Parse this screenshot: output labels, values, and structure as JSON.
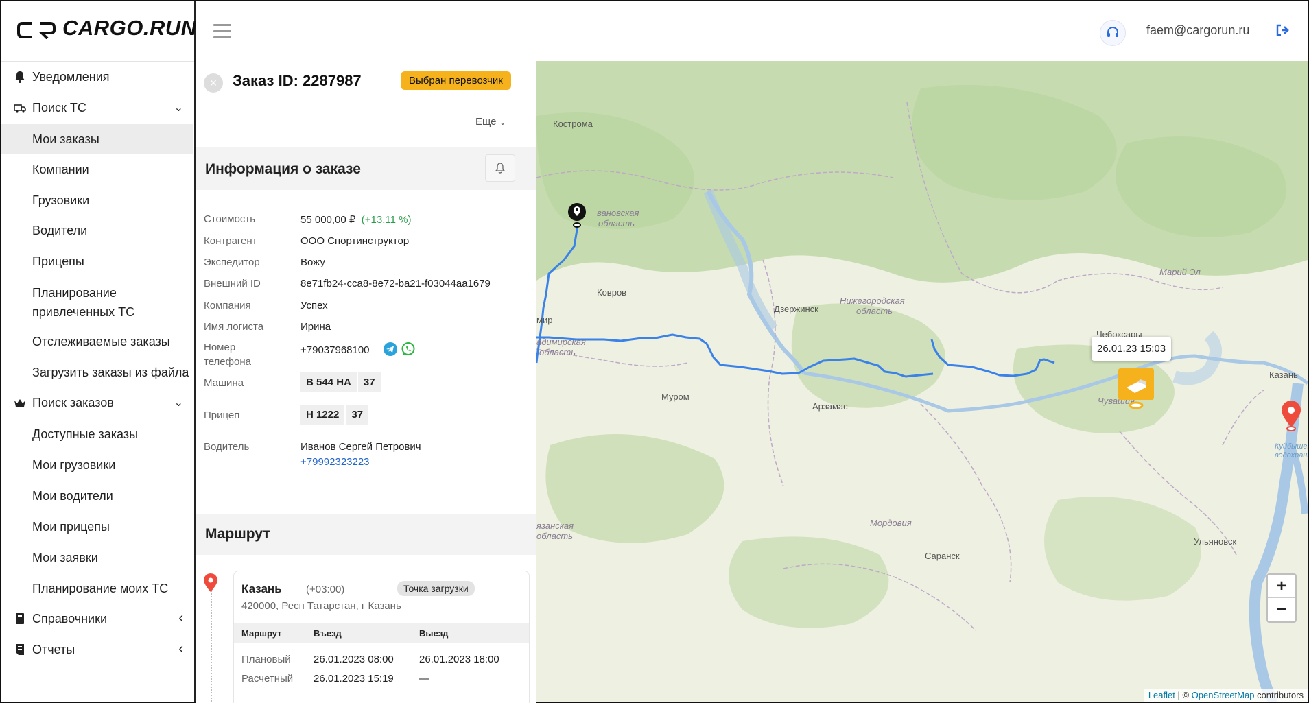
{
  "app": {
    "logo_text": "CARGO.RUN"
  },
  "sidebar": {
    "items": [
      {
        "label": "Уведомления",
        "icon": "bell-icon"
      },
      {
        "label": "Поиск ТС",
        "icon": "truck-icon"
      },
      {
        "label": "Мои заказы"
      },
      {
        "label": "Компании"
      },
      {
        "label": "Грузовики"
      },
      {
        "label": "Водители"
      },
      {
        "label": "Прицепы"
      },
      {
        "label": "Планирование привлеченных ТС"
      },
      {
        "label": "Отслеживаемые заказы"
      },
      {
        "label": "Загрузить заказы из файла"
      },
      {
        "label": "Поиск заказов",
        "icon": "crown-icon"
      },
      {
        "label": "Доступные заказы"
      },
      {
        "label": "Мои грузовики"
      },
      {
        "label": "Мои водители"
      },
      {
        "label": "Мои прицепы"
      },
      {
        "label": "Мои заявки"
      },
      {
        "label": "Планирование моих ТС"
      },
      {
        "label": "Справочники",
        "icon": "book-icon"
      },
      {
        "label": "Отчеты",
        "icon": "report-icon"
      }
    ]
  },
  "header": {
    "user_email": "faem@cargorun.ru"
  },
  "order": {
    "title": "Заказ ID: 2287987",
    "status": "Выбран перевозчик",
    "more_label": "Еще",
    "info_title": "Информация о заказе",
    "fields": {
      "cost_label": "Стоимость",
      "cost_value": "55 000,00 ₽",
      "cost_change": "(+13,11 %)",
      "counterparty_label": "Контрагент",
      "counterparty_value": "ООО Спортинструктор",
      "forwarder_label": "Экспедитор",
      "forwarder_value": "Вожу",
      "external_id_label": "Внешний ID",
      "external_id_value": "8e71fb24-cca8-8e72-ba21-f03044aa1679",
      "company_label": "Компания",
      "company_value": "Успех",
      "logist_label": "Имя логиста",
      "logist_value": "Ирина",
      "phone_label_1": "Номер",
      "phone_label_2": "телефона",
      "phone_value": "+79037968100",
      "vehicle_label": "Машина",
      "vehicle_plate": "В 544 НА",
      "vehicle_region": "37",
      "trailer_label": "Прицеп",
      "trailer_plate": "Н 1222",
      "trailer_region": "37",
      "driver_label": "Водитель",
      "driver_name": "Иванов Сергей Петрович",
      "driver_phone": "+79992323223"
    },
    "route_title": "Маршрут",
    "stop": {
      "city": "Казань",
      "tz": "(+03:00)",
      "badge": "Точка загрузки",
      "address": "420000, Респ Татарстан, г Казань",
      "col_route": "Маршрут",
      "col_in": "Въезд",
      "col_out": "Выезд",
      "row1_label": "Плановый",
      "row1_in": "26.01.2023 08:00",
      "row1_out": "26.01.2023 18:00",
      "row2_label": "Расчетный",
      "row2_in": "26.01.2023 15:19",
      "row2_out": "—"
    }
  },
  "map": {
    "tooltip": "26.01.23 15:03",
    "labels": {
      "kostroma": "Кострома",
      "ivanovo_1": "вановская",
      "ivanovo_2": "область",
      "kovrov": "Ковров",
      "dzerzhinsk": "Дзержинск",
      "nizh_1": "Нижегородская",
      "nizh_2": "область",
      "vlad_city": "мир",
      "vlad_1": "адимирская",
      "vlad_2": "область",
      "murom": "Муром",
      "arzamas": "Арзамас",
      "cheboksary": "Чебоксары",
      "mariel": "Марий Эл",
      "chuvash": "Чувашия",
      "kazan": "Казань",
      "mordovia": "Мордовия",
      "saransk": "Саранск",
      "ulyanovsk": "Ульяновск",
      "kuib_1": "Куйбышев",
      "kuib_2": "водохрани",
      "ryaz_1": "язанская",
      "ryaz_2": "область"
    },
    "zoom_in": "+",
    "zoom_out": "−",
    "attrib_leaflet": "Leaflet",
    "attrib_sep": " | © ",
    "attrib_osm": "OpenStreetMap",
    "attrib_tail": " contributors"
  }
}
